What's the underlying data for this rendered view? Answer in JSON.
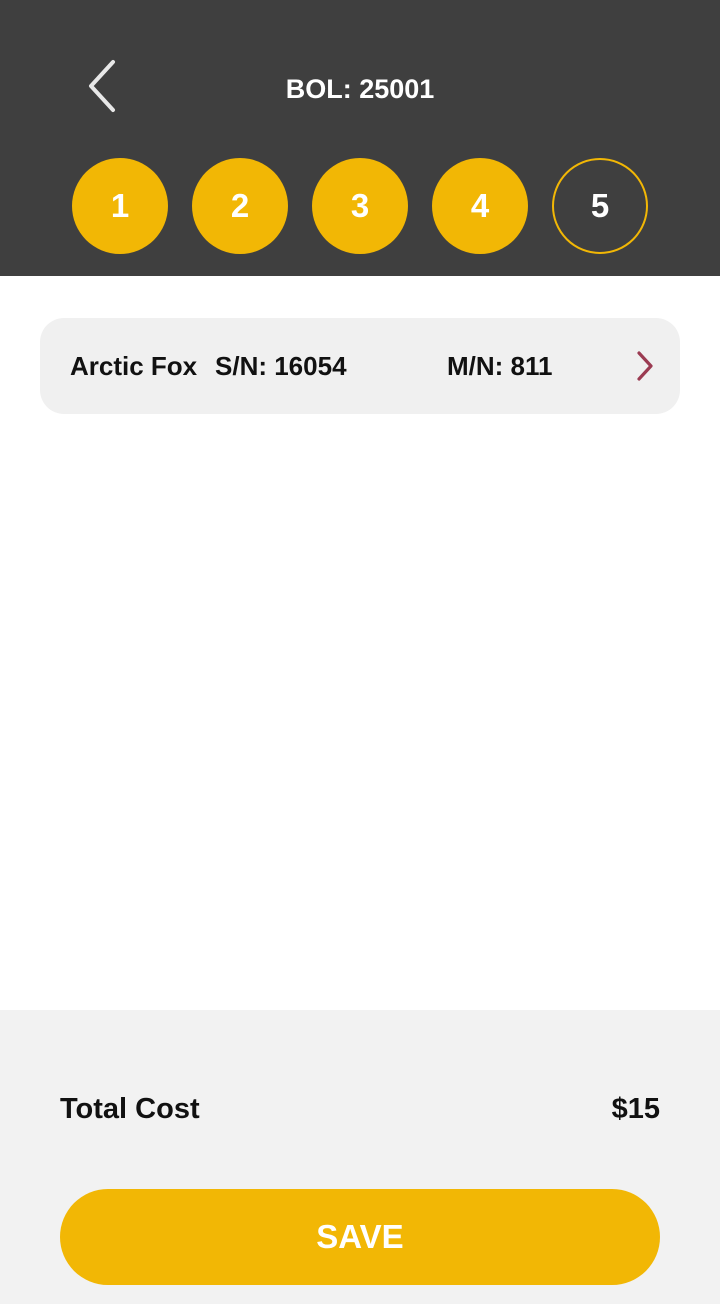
{
  "header": {
    "title": "BOL: 25001",
    "back_icon": "chevron-left-icon",
    "steps": [
      {
        "label": "1",
        "state": "done"
      },
      {
        "label": "2",
        "state": "done"
      },
      {
        "label": "3",
        "state": "done"
      },
      {
        "label": "4",
        "state": "done"
      },
      {
        "label": "5",
        "state": "current"
      }
    ]
  },
  "items": [
    {
      "name": "Arctic Fox",
      "serial": "S/N: 16054",
      "model": "M/N: 811",
      "icon": "chevron-right-icon"
    }
  ],
  "footer": {
    "total_label": "Total Cost",
    "total_value": "$15",
    "save_label": "SAVE"
  },
  "colors": {
    "header_bg": "#3f3f3f",
    "accent": "#f2b705",
    "chevron": "#9b3b52",
    "card_bg": "#f0f0f0",
    "footer_bg": "#f2f2f2"
  }
}
